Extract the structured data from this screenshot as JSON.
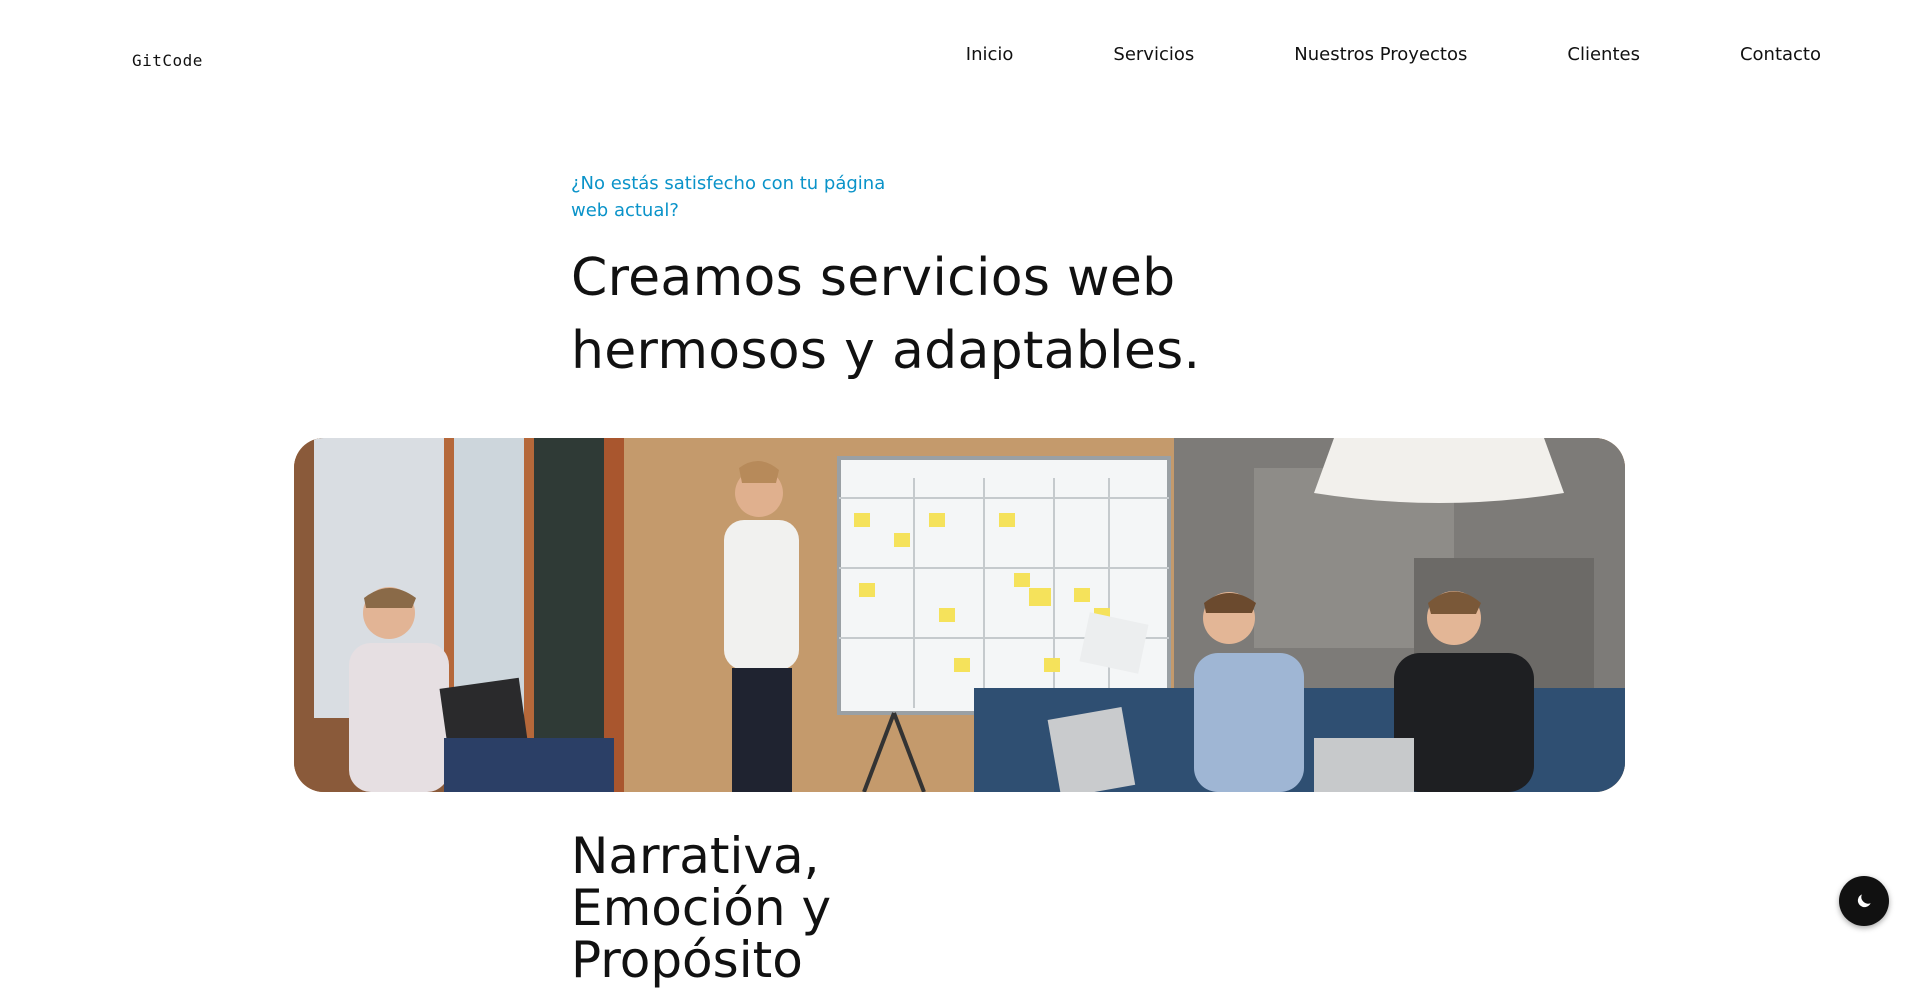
{
  "brand": {
    "logo_text": "GitCode"
  },
  "nav": {
    "items": [
      {
        "label": "Inicio"
      },
      {
        "label": "Servicios"
      },
      {
        "label": "Nuestros Proyectos"
      },
      {
        "label": "Clientes"
      },
      {
        "label": "Contacto"
      }
    ]
  },
  "hero": {
    "eyebrow": "¿No estás satisfecho con tu página web actual?",
    "headline": "Creamos servicios web hermosos y adaptables."
  },
  "section": {
    "title": "Narrativa, Emoción y Propósito"
  },
  "theme_toggle": {
    "icon": "moon-icon"
  },
  "colors": {
    "accent": "#0a93c9",
    "text": "#111111",
    "background": "#ffffff"
  }
}
